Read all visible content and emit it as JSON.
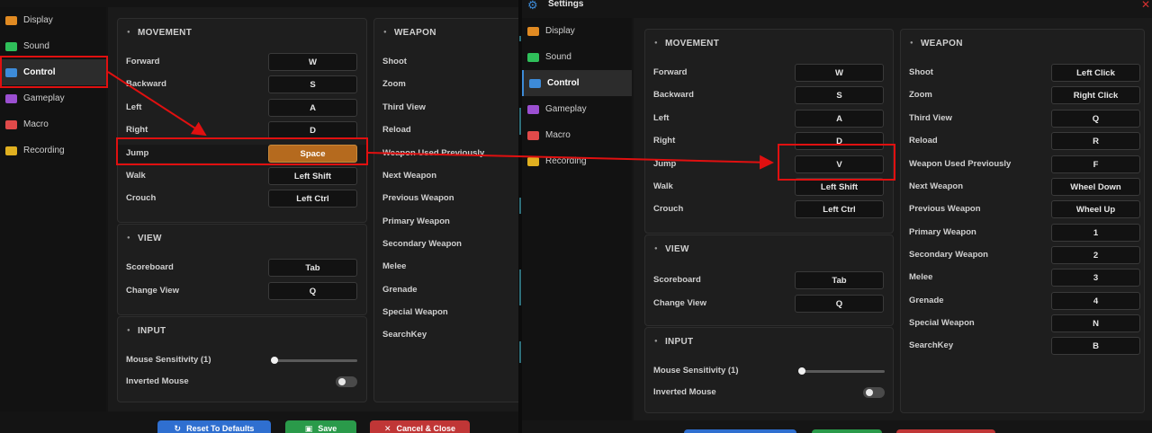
{
  "sidebar": {
    "items": [
      {
        "label": "Display",
        "icon": "monitor-icon",
        "color": "#e08a22"
      },
      {
        "label": "Sound",
        "icon": "speaker-icon",
        "color": "#2fbf5a"
      },
      {
        "label": "Control",
        "icon": "keyboard-icon",
        "color": "#3d8bd8"
      },
      {
        "label": "Gameplay",
        "icon": "gamepad-icon",
        "color": "#9b4fd1"
      },
      {
        "label": "Macro",
        "icon": "gamepad-icon",
        "color": "#e04a4a"
      },
      {
        "label": "Recording",
        "icon": "camera-icon",
        "color": "#e0b020"
      }
    ],
    "active_index": 2
  },
  "movement": {
    "title": "MOVEMENT",
    "rows_left": [
      {
        "label": "Forward",
        "key": "W"
      },
      {
        "label": "Backward",
        "key": "S"
      },
      {
        "label": "Left",
        "key": "A"
      },
      {
        "label": "Right",
        "key": "D"
      },
      {
        "label": "Jump",
        "key": "Space"
      },
      {
        "label": "Walk",
        "key": "Left Shift"
      },
      {
        "label": "Crouch",
        "key": "Left Ctrl"
      }
    ],
    "rows_right": [
      {
        "label": "Forward",
        "key": "W"
      },
      {
        "label": "Backward",
        "key": "S"
      },
      {
        "label": "Left",
        "key": "A"
      },
      {
        "label": "Right",
        "key": "D"
      },
      {
        "label": "Jump",
        "key": "V"
      },
      {
        "label": "Walk",
        "key": "Left Shift"
      },
      {
        "label": "Crouch",
        "key": "Left Ctrl"
      }
    ]
  },
  "view": {
    "title": "VIEW",
    "rows": [
      {
        "label": "Scoreboard",
        "key": "Tab"
      },
      {
        "label": "Change View",
        "key": "Q"
      }
    ]
  },
  "input": {
    "title": "INPUT",
    "sensitivity_label": "Mouse Sensitivity (1)",
    "sensitivity_value": 1,
    "inverted_label": "Inverted Mouse",
    "inverted_on": false
  },
  "weapon": {
    "title": "WEAPON",
    "labels": [
      "Shoot",
      "Zoom",
      "Third View",
      "Reload",
      "Weapon Used Previously",
      "Next Weapon",
      "Previous Weapon",
      "Primary Weapon",
      "Secondary Weapon",
      "Melee",
      "Grenade",
      "Special Weapon",
      "SearchKey"
    ],
    "keys": [
      "Left Click",
      "Right Click",
      "Q",
      "R",
      "F",
      "Wheel Down",
      "Wheel Up",
      "1",
      "2",
      "3",
      "4",
      "N",
      "B"
    ]
  },
  "footer": {
    "reset_label": "Reset To Defaults",
    "save_label": "Save",
    "cancel_label": "Cancel & Close",
    "reset_color": "#2f6fd0",
    "save_color": "#2a9a4a",
    "cancel_color": "#c03636"
  },
  "window": {
    "title": "Settings"
  },
  "colors": {
    "highlight_key": "#b56a1e",
    "annotation": "#e01010"
  }
}
